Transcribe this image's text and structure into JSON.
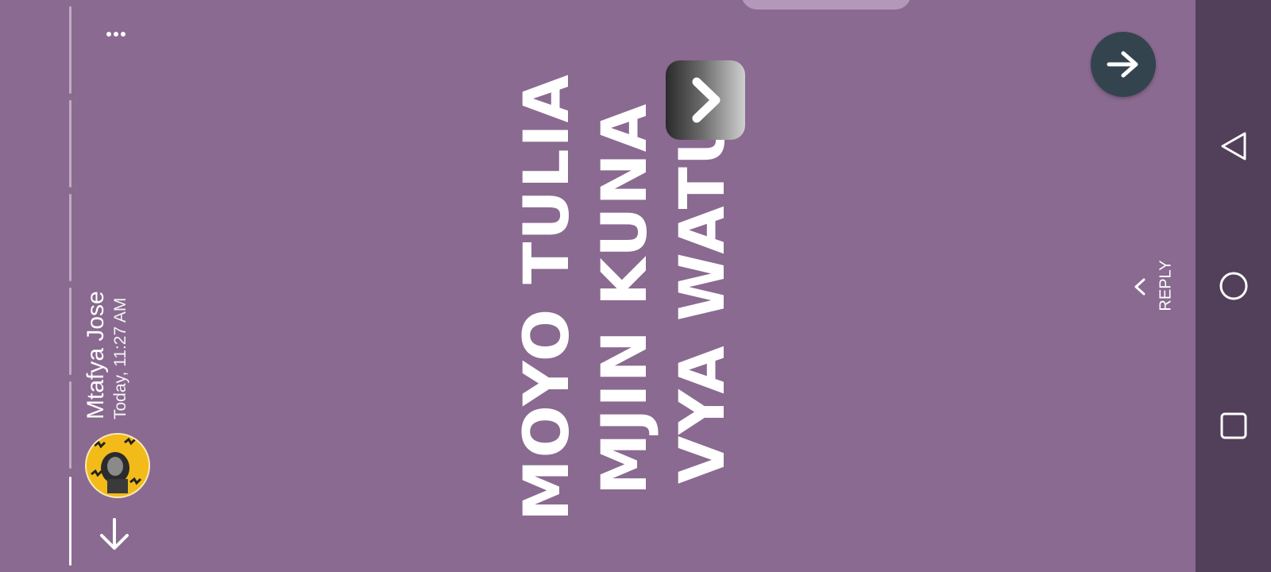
{
  "status": {
    "user_name": "Mtafya Jose",
    "timestamp": "Today, 11:27 AM"
  },
  "story": {
    "lines": [
      "MOYO TULIA",
      "MJIN KUNA",
      "VYA WATU"
    ],
    "background_color": "#8a6a90",
    "text_color": "#ffffff"
  },
  "actions": {
    "reply_label": "REPLY",
    "more_icon": "more-horizontal-icon",
    "down_icon": "arrow-down-icon",
    "forward_icon": "arrow-right-icon",
    "next_icon": "chevron-right-icon"
  },
  "progress": {
    "segments_total": 6,
    "current_segment": 6
  },
  "nav_bar": {
    "buttons": [
      "back-triangle-icon",
      "home-circle-icon",
      "recents-square-icon"
    ],
    "color": "#523f59"
  }
}
